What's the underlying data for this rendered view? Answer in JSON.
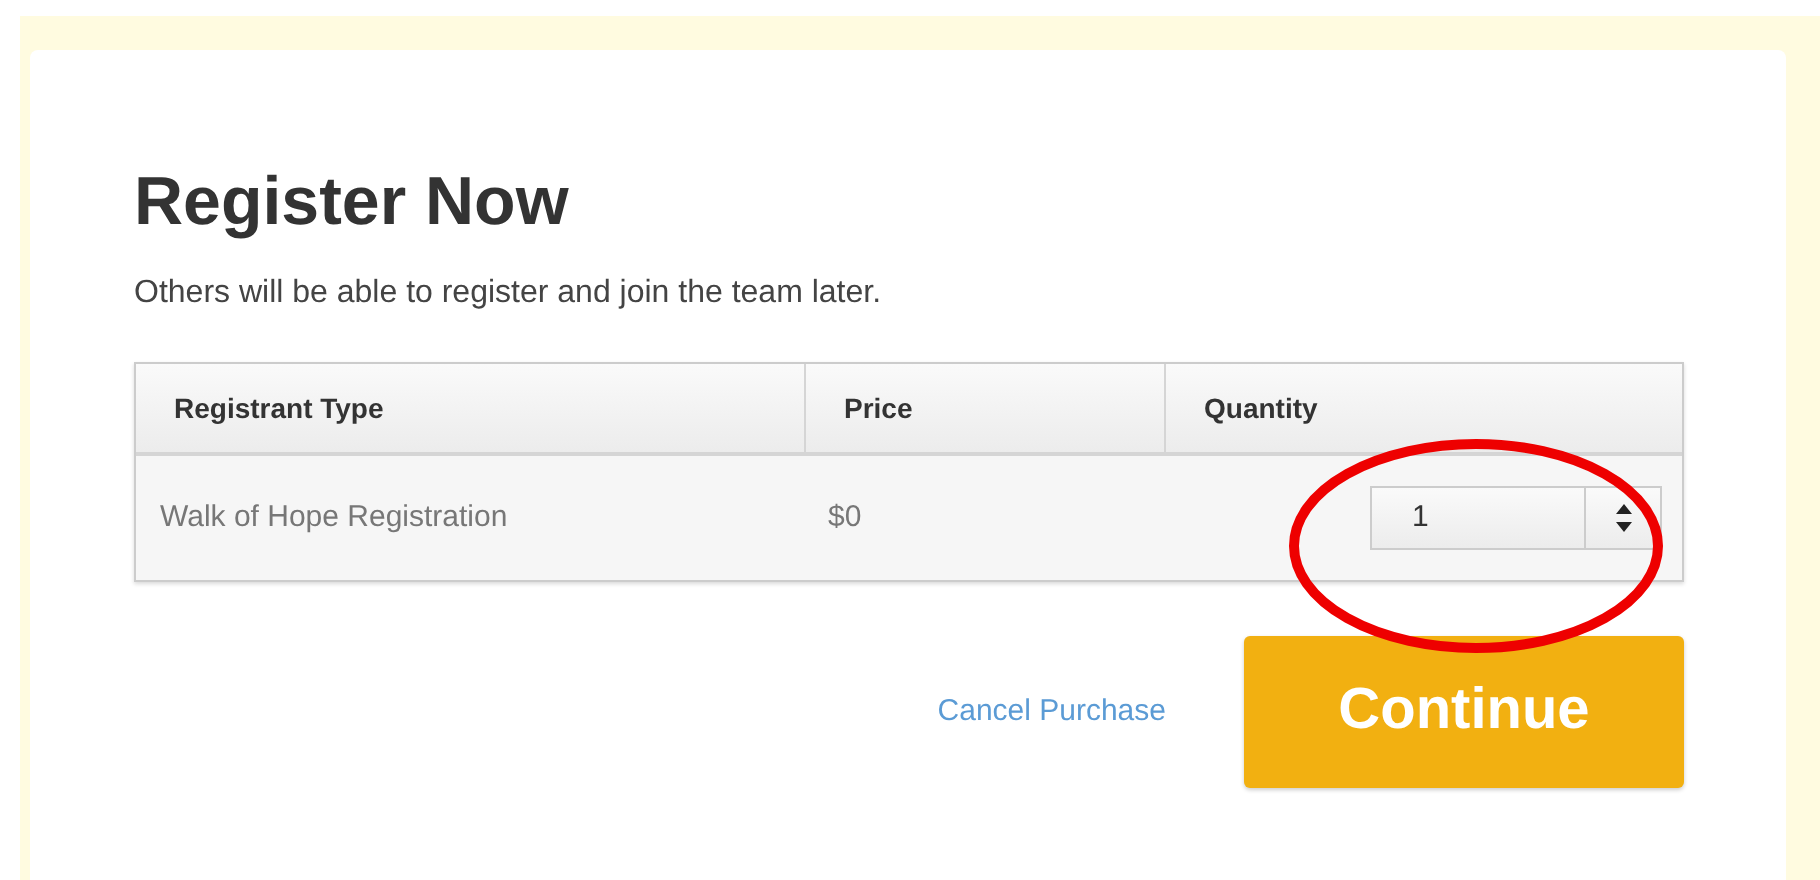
{
  "title": "Register Now",
  "subtitle": "Others will be able to register and join the team later.",
  "table": {
    "columns": [
      "Registrant Type",
      "Price",
      "Quantity"
    ],
    "rows": [
      {
        "type": "Walk of Hope Registration",
        "price": "$0",
        "quantity": "1"
      }
    ]
  },
  "cancel_link": "Cancel Purchase",
  "continue_button": "Continue"
}
